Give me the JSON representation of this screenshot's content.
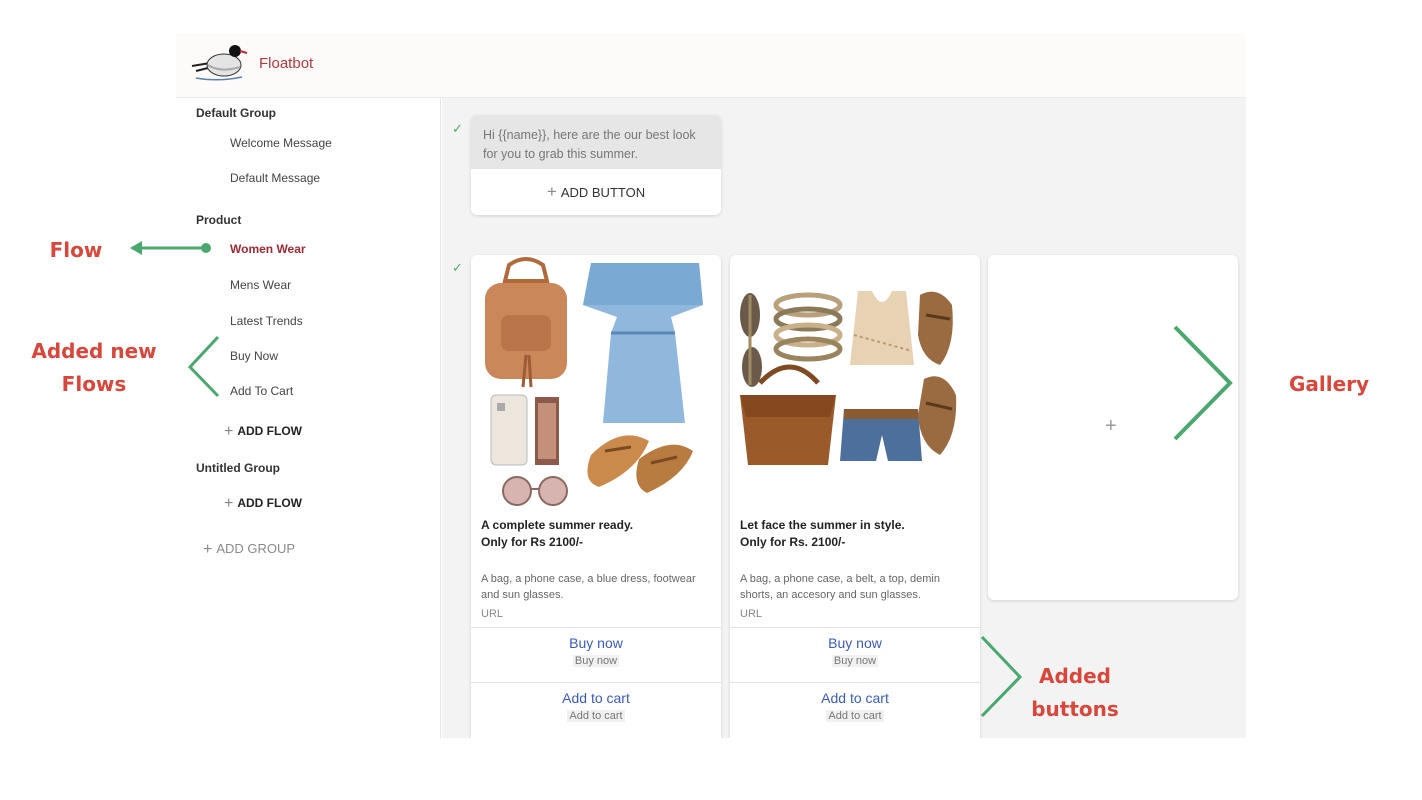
{
  "app": {
    "brand": "Floatbot"
  },
  "sidebar": {
    "groups": [
      {
        "title": "Default Group",
        "items": [
          "Welcome Message",
          "Default Message"
        ]
      },
      {
        "title": "Product",
        "items": [
          "Women Wear",
          "Mens Wear",
          "Latest Trends",
          "Buy Now",
          "Add To Cart"
        ],
        "add_flow": "ADD FLOW"
      },
      {
        "title": "Untitled Group",
        "add_flow": "ADD FLOW"
      }
    ],
    "add_group": "ADD GROUP"
  },
  "main": {
    "text_card": {
      "message": "Hi {{name}}, here are the our best look for you to grab this summer.",
      "add_button": "ADD BUTTON"
    },
    "gallery": [
      {
        "title_line1": "A complete summer ready.",
        "title_line2": "Only for Rs 2100/-",
        "description": "A bag, a phone case, a blue dress, footwear and sun glasses.",
        "url": "URL",
        "buttons": [
          {
            "label": "Buy now",
            "sub": "Buy now"
          },
          {
            "label": "Add to cart",
            "sub": "Add to cart"
          }
        ]
      },
      {
        "title_line1": "Let face the summer in style.",
        "title_line2": "Only for Rs. 2100/-",
        "description": "A bag, a phone case, a belt, a top, demin shorts, an accesory and sun glasses.",
        "url": "URL",
        "buttons": [
          {
            "label": "Buy now",
            "sub": "Buy now"
          },
          {
            "label": "Add to cart",
            "sub": "Add to cart"
          }
        ]
      }
    ]
  },
  "annotations": {
    "flow": "Flow",
    "added_new_flows_1": "Added new",
    "added_new_flows_2": "Flows",
    "gallery": "Gallery",
    "added_buttons_1": "Added",
    "added_buttons_2": "buttons"
  },
  "colors": {
    "brand": "#b03a3e",
    "active_flow": "#9c2a33",
    "link": "#3b5cb8",
    "annotation_text": "#d8473c",
    "annotation_arrow": "#4aa86f"
  }
}
